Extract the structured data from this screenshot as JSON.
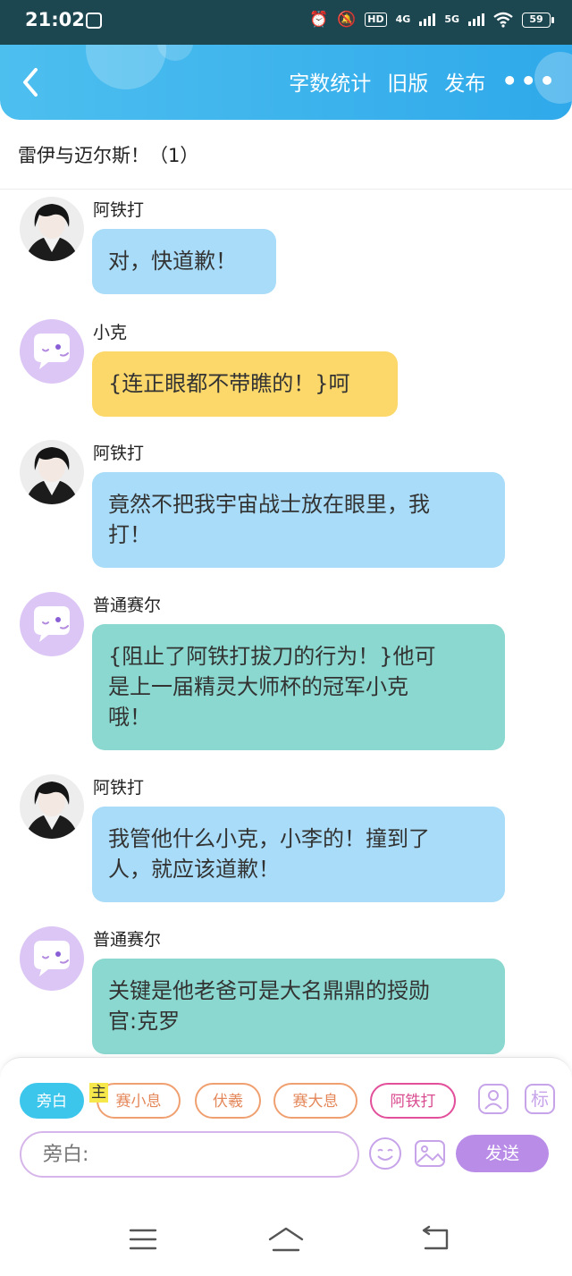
{
  "status_bar": {
    "time": "21:02",
    "hd_label": "HD",
    "net_4g": "4G",
    "net_5g": "5G",
    "battery": "59"
  },
  "header": {
    "back_icon": "chevron-left-icon",
    "word_count": "字数统计",
    "old_version": "旧版",
    "publish": "发布",
    "more": "•••",
    "gradient": [
      "#4dbfef",
      "#2fa9ea"
    ]
  },
  "story_title": "雷伊与迈尔斯！（1）",
  "messages": [
    {
      "name": "阿铁打",
      "text": "对，快道歉！",
      "bubble_color": "#a8dcf8",
      "avatar": "anime-avatar"
    },
    {
      "name": "小克",
      "text": "{连正眼都不带瞧的！}呵",
      "bubble_color": "#fcd86a",
      "avatar": "default-avatar"
    },
    {
      "name": "阿铁打",
      "line1": "竟然不把我宇宙战士放在眼里，我",
      "line2": "打！",
      "bubble_color": "#a8dcf8",
      "avatar": "anime-avatar"
    },
    {
      "name": "普通赛尔",
      "line1": "{阻止了阿铁打拔刀的行为！}他可",
      "line2": "是上一届精灵大师杯的冠军小克",
      "line3": "哦！",
      "bubble_color": "#8ad8cf",
      "avatar": "default-avatar"
    },
    {
      "name": "阿铁打",
      "line1": "我管他什么小克，小李的！撞到了",
      "line2": "人，就应该道歉！",
      "bubble_color": "#a8dcf8",
      "avatar": "anime-avatar"
    },
    {
      "name": "普通赛尔",
      "line1": "关键是他老爸可是大名鼎鼎的授勋",
      "line2": "官:克罗",
      "bubble_color": "#8ad8cf",
      "avatar": "default-avatar"
    }
  ],
  "panel": {
    "chips": [
      "旁白",
      "赛小息",
      "伏羲",
      "赛大息",
      "阿铁打"
    ],
    "main_tag": "主",
    "mark_label": "标",
    "input_placeholder": "旁白:",
    "send": "发送",
    "active_color": "#3cc6ec",
    "send_color": "#b98ce8"
  }
}
